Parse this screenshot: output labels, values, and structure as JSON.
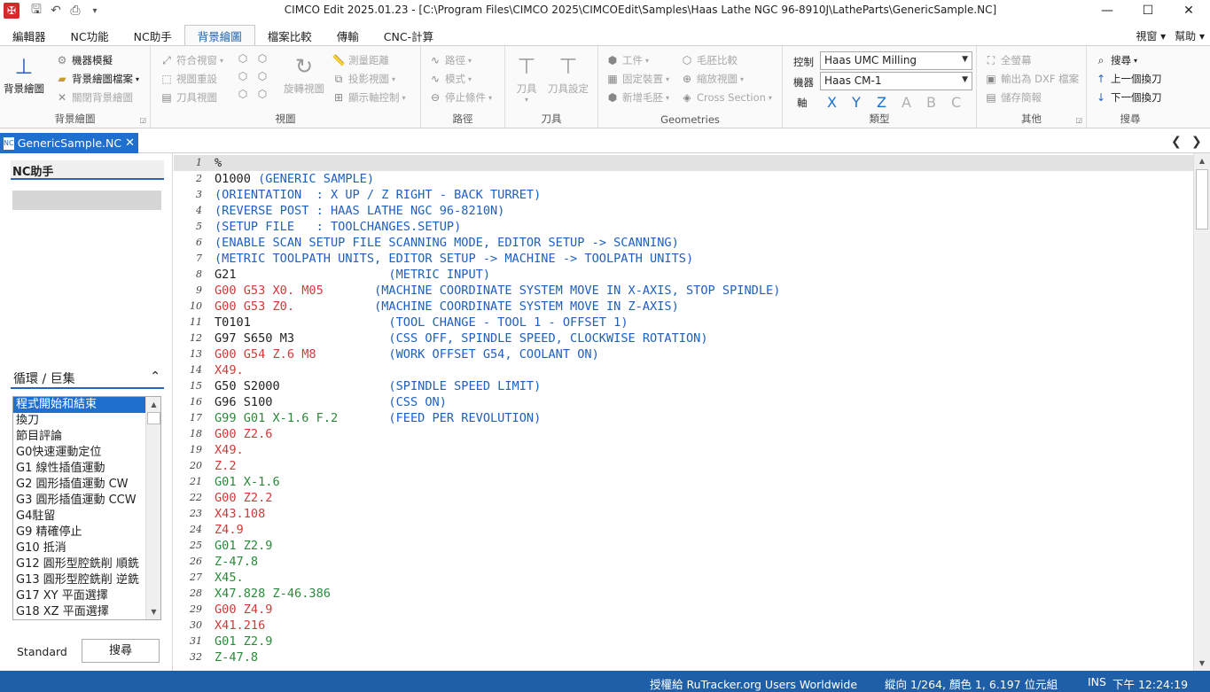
{
  "titlebar": {
    "title": "CIMCO Edit 2025.01.23 - [C:\\Program Files\\CIMCO 2025\\CIMCOEdit\\Samples\\Haas Lathe NGC 96-8910J\\LatheParts\\GenericSample.NC]",
    "minimize": "—",
    "maximize": "☐",
    "close": "✕"
  },
  "tabs": {
    "items": [
      "編輯器",
      "NC功能",
      "NC助手",
      "背景繪圖",
      "檔案比較",
      "傳輸",
      "CNC-計算"
    ],
    "right": [
      "視窗 ▾",
      "幫助 ▾"
    ]
  },
  "ribbon": {
    "group1": {
      "big": "背景繪圖",
      "items": [
        "機器模擬",
        "背景繪圖檔案",
        "關閉背景繪圖"
      ],
      "label": "背景繪圖"
    },
    "group2": {
      "items": [
        "符合視窗",
        "視圖重設",
        "刀具視圖",
        "旋轉視圖",
        "測量距離",
        "投影視圖",
        "顯示軸控制"
      ],
      "label": "視圖"
    },
    "group3": {
      "items": [
        "路徑",
        "模式",
        "停止條件"
      ],
      "label": "路徑"
    },
    "group4": {
      "items": [
        "刀具",
        "刀具設定"
      ],
      "label": "刀具"
    },
    "group5": {
      "items": [
        "工件",
        "毛胚比較",
        "固定裝置",
        "縮放視圖",
        "新增毛胚",
        "Cross Section"
      ],
      "label": "Geometries"
    },
    "group6": {
      "control_label": "控制",
      "machine_label": "機器",
      "axis_label": "軸",
      "control_value": "Haas UMC Milling",
      "machine_value": "Haas CM-1",
      "axes": [
        "X",
        "Y",
        "Z",
        "A",
        "B",
        "C"
      ],
      "label": "類型"
    },
    "group7": {
      "items": [
        "全螢幕",
        "輸出為 DXF 檔案",
        "儲存簡報"
      ],
      "label": "其他"
    },
    "group8": {
      "items": [
        "搜尋",
        "上一個換刀",
        "下一個換刀"
      ],
      "label": "搜尋"
    }
  },
  "doc_tab": {
    "label": "GenericSample.NC",
    "icon": "NC",
    "close": "✕"
  },
  "left_panel": {
    "title": "NC助手",
    "cycles_title": "循環 / 巨集",
    "cycles": [
      "程式開始和結束",
      "換刀",
      "節目評論",
      "G0快速運動定位",
      "G1 線性插值運動",
      "G2 圓形插值運動 CW",
      "G3 圓形插值運動 CCW",
      "G4駐留",
      "G9 精確停止",
      "G10 抵消",
      "G12 圓形型腔銑削 順銑",
      "G13 圓形型腔銑削 逆銑",
      "G17 XY 平面選擇",
      "G18 XZ 平面選擇"
    ],
    "standard_label": "Standard",
    "search_button": "搜尋"
  },
  "editor": {
    "lines": [
      {
        "n": "1",
        "segs": [
          [
            "%",
            "black"
          ]
        ]
      },
      {
        "n": "2",
        "segs": [
          [
            "O1000 ",
            "black"
          ],
          [
            "(GENERIC SAMPLE)",
            "blue"
          ]
        ]
      },
      {
        "n": "3",
        "segs": [
          [
            "(ORIENTATION  : X UP / Z RIGHT - BACK TURRET)",
            "blue"
          ]
        ]
      },
      {
        "n": "4",
        "segs": [
          [
            "(REVERSE POST : HAAS LATHE NGC 96-8210N)",
            "blue"
          ]
        ]
      },
      {
        "n": "5",
        "segs": [
          [
            "(SETUP FILE   : TOOLCHANGES.SETUP)",
            "blue"
          ]
        ]
      },
      {
        "n": "6",
        "segs": [
          [
            "(ENABLE SCAN SETUP FILE SCANNING MODE, EDITOR SETUP -> SCANNING)",
            "blue"
          ]
        ]
      },
      {
        "n": "7",
        "segs": [
          [
            "(METRIC TOOLPATH UNITS, EDITOR SETUP -> MACHINE -> TOOLPATH UNITS)",
            "blue"
          ]
        ]
      },
      {
        "n": "8",
        "segs": [
          [
            "G21                     ",
            "black"
          ],
          [
            "(METRIC INPUT)",
            "blue"
          ]
        ]
      },
      {
        "n": "9",
        "segs": [
          [
            "G00 G53 X0. M05       ",
            "red"
          ],
          [
            "(MACHINE COORDINATE SYSTEM MOVE IN X-AXIS, STOP SPINDLE)",
            "blue"
          ]
        ]
      },
      {
        "n": "10",
        "segs": [
          [
            "G00 G53 Z0.           ",
            "red"
          ],
          [
            "(MACHINE COORDINATE SYSTEM MOVE IN Z-AXIS)",
            "blue"
          ]
        ]
      },
      {
        "n": "11",
        "segs": [
          [
            "T0101                   ",
            "black"
          ],
          [
            "(TOOL CHANGE - TOOL 1 - OFFSET 1)",
            "blue"
          ]
        ]
      },
      {
        "n": "12",
        "segs": [
          [
            "G97 S650 M3             ",
            "black"
          ],
          [
            "(CSS OFF, SPINDLE SPEED, CLOCKWISE ROTATION)",
            "blue"
          ]
        ]
      },
      {
        "n": "13",
        "segs": [
          [
            "G00 G54 Z.6 M8          ",
            "red"
          ],
          [
            "(WORK OFFSET G54, COOLANT ON)",
            "blue"
          ]
        ]
      },
      {
        "n": "14",
        "segs": [
          [
            "X49.",
            "red"
          ]
        ]
      },
      {
        "n": "15",
        "segs": [
          [
            "G50 S2000               ",
            "black"
          ],
          [
            "(SPINDLE SPEED LIMIT)",
            "blue"
          ]
        ]
      },
      {
        "n": "16",
        "segs": [
          [
            "G96 S100                ",
            "black"
          ],
          [
            "(CSS ON)",
            "blue"
          ]
        ]
      },
      {
        "n": "17",
        "segs": [
          [
            "G99 G01 X-1.6 F.2       ",
            "green"
          ],
          [
            "(FEED PER REVOLUTION)",
            "blue"
          ]
        ]
      },
      {
        "n": "18",
        "segs": [
          [
            "G00 Z2.6",
            "red"
          ]
        ]
      },
      {
        "n": "19",
        "segs": [
          [
            "X49.",
            "red"
          ]
        ]
      },
      {
        "n": "20",
        "segs": [
          [
            "Z.2",
            "red"
          ]
        ]
      },
      {
        "n": "21",
        "segs": [
          [
            "G01 X-1.6",
            "green"
          ]
        ]
      },
      {
        "n": "22",
        "segs": [
          [
            "G00 Z2.2",
            "red"
          ]
        ]
      },
      {
        "n": "23",
        "segs": [
          [
            "X43.108",
            "red"
          ]
        ]
      },
      {
        "n": "24",
        "segs": [
          [
            "Z4.9",
            "red"
          ]
        ]
      },
      {
        "n": "25",
        "segs": [
          [
            "G01 Z2.9",
            "green"
          ]
        ]
      },
      {
        "n": "26",
        "segs": [
          [
            "Z-47.8",
            "green"
          ]
        ]
      },
      {
        "n": "27",
        "segs": [
          [
            "X45.",
            "green"
          ]
        ]
      },
      {
        "n": "28",
        "segs": [
          [
            "X47.828 Z-46.386",
            "green"
          ]
        ]
      },
      {
        "n": "29",
        "segs": [
          [
            "G00 Z4.9",
            "red"
          ]
        ]
      },
      {
        "n": "30",
        "segs": [
          [
            "X41.216",
            "red"
          ]
        ]
      },
      {
        "n": "31",
        "segs": [
          [
            "G01 Z2.9",
            "green"
          ]
        ]
      },
      {
        "n": "32",
        "segs": [
          [
            "Z-47.8",
            "green"
          ]
        ]
      }
    ]
  },
  "statusbar": {
    "license": "授權給 RuTracker.org Users Worldwide",
    "position": "縱向 1/264, 顏色 1, 6.197 位元組",
    "mode": "INS",
    "time": "下午 12:24:19"
  },
  "colors": {
    "accent": "#1f6fcf",
    "statusbar": "#1f5fa8",
    "comment": "#1f5fbf",
    "rapid": "#d03a3a",
    "feed": "#2a8a3a"
  }
}
